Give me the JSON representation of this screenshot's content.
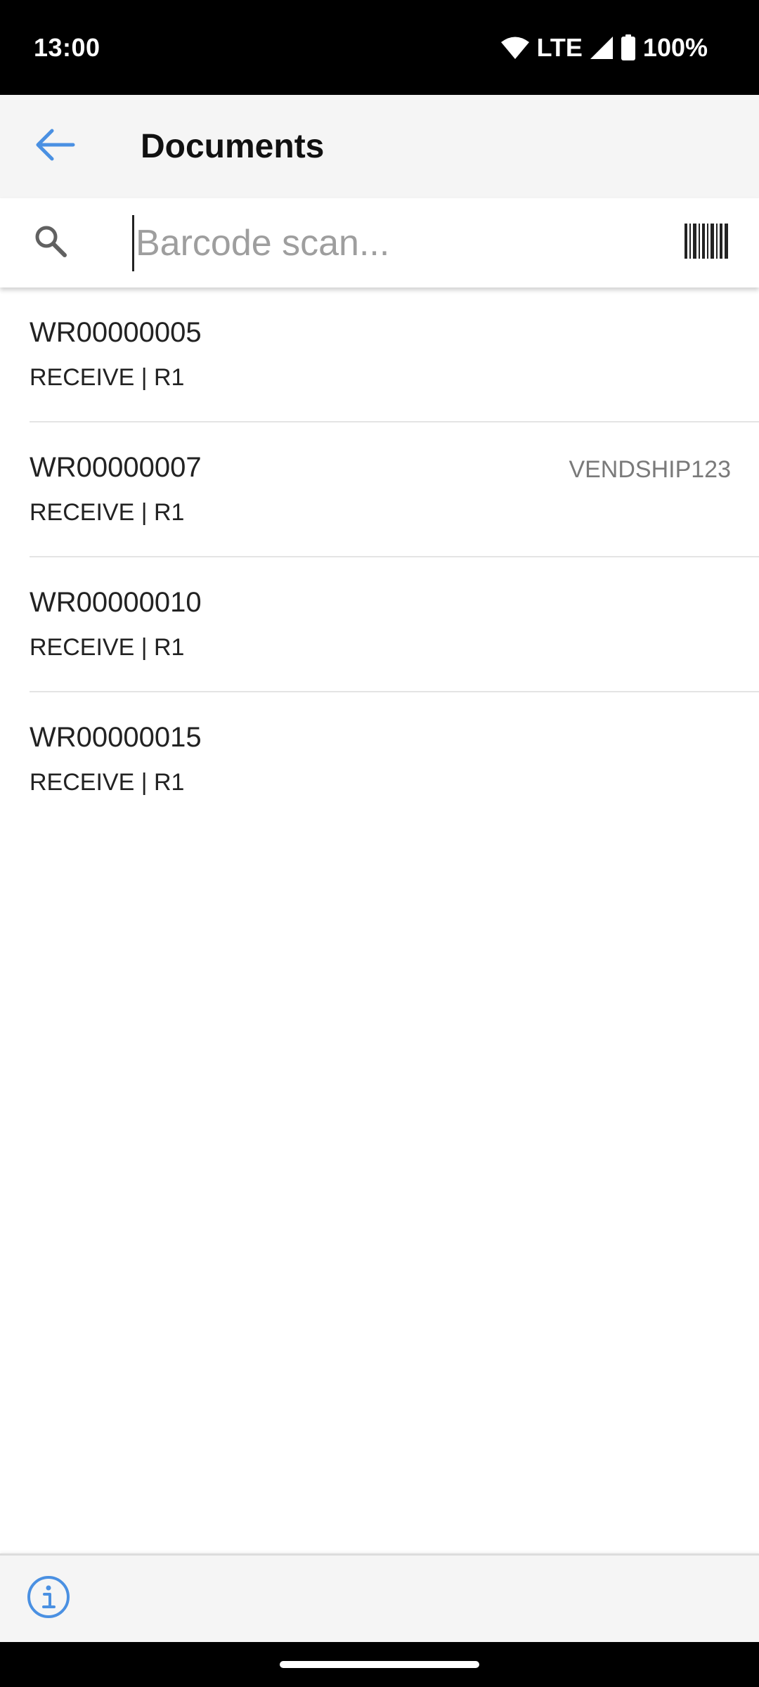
{
  "status_bar": {
    "time": "13:00",
    "network": "LTE",
    "battery": "100%",
    "icons": [
      "wifi-icon",
      "cell-signal-icon",
      "battery-icon"
    ]
  },
  "app_bar": {
    "title": "Documents",
    "back_icon": "arrow-left-icon"
  },
  "search": {
    "placeholder": "Barcode scan...",
    "value": "",
    "search_icon": "search-icon",
    "scan_icon": "barcode-icon"
  },
  "documents": [
    {
      "id": "WR00000005",
      "subtitle": "RECEIVE | R1",
      "reference": ""
    },
    {
      "id": "WR00000007",
      "subtitle": "RECEIVE | R1",
      "reference": "VENDSHIP123"
    },
    {
      "id": "WR00000010",
      "subtitle": "RECEIVE | R1",
      "reference": ""
    },
    {
      "id": "WR00000015",
      "subtitle": "RECEIVE | R1",
      "reference": ""
    }
  ],
  "bottom_bar": {
    "info_icon": "info-icon"
  },
  "colors": {
    "accent": "#4a90e2",
    "app_bar_bg": "#f5f5f5",
    "text_primary": "#222222",
    "text_secondary": "#7a7a7a"
  }
}
